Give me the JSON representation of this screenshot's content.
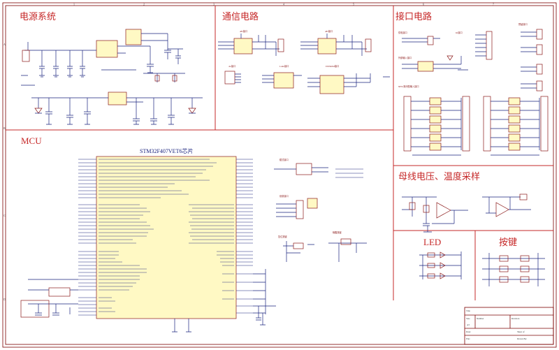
{
  "sections": {
    "power": "电源系统",
    "comm": "通信电路",
    "interface": "接口电路",
    "mcu": "MCU",
    "bus": "母线电压、温度采样",
    "led": "LED",
    "keys": "按键"
  },
  "mcu": {
    "chip_title": "STM32F407VET6芯片"
  },
  "comm": {
    "rs485_1": "485接口",
    "rs485_2": "485接口",
    "can": "4G接口",
    "lora": "LoRa接口",
    "eeprom": "EEPROM接口"
  },
  "interface": {
    "power_io": "供电接口",
    "io_port": "IO接口",
    "ext_input": "外部输入接口",
    "npn_input": "NPN/常闭型输入接口",
    "preset": "预留接口"
  },
  "mcu_side": {
    "mode_port": "模式接口",
    "debug_port": "烧录接口",
    "reset_key": "复位按键",
    "wakeup_key": "唤醒按键"
  },
  "titleblock": {
    "title_label": "Title",
    "size_label": "Size",
    "size_value": "A3",
    "number_label": "Number",
    "revision_label": "Revision",
    "date_label": "Date:",
    "file_label": "File:",
    "sheet_label": "Sheet of",
    "drawn_label": "Drawn By:"
  },
  "zones": {
    "cols": [
      "1",
      "2",
      "3",
      "4",
      "5",
      "6",
      "7",
      "8"
    ],
    "rows": [
      "A",
      "B",
      "C",
      "D"
    ]
  },
  "colors": {
    "section_title": "#c62828",
    "wire": "#1a237e",
    "part_outline": "#8b1a1a",
    "chip_fill": "#fff9c4"
  }
}
